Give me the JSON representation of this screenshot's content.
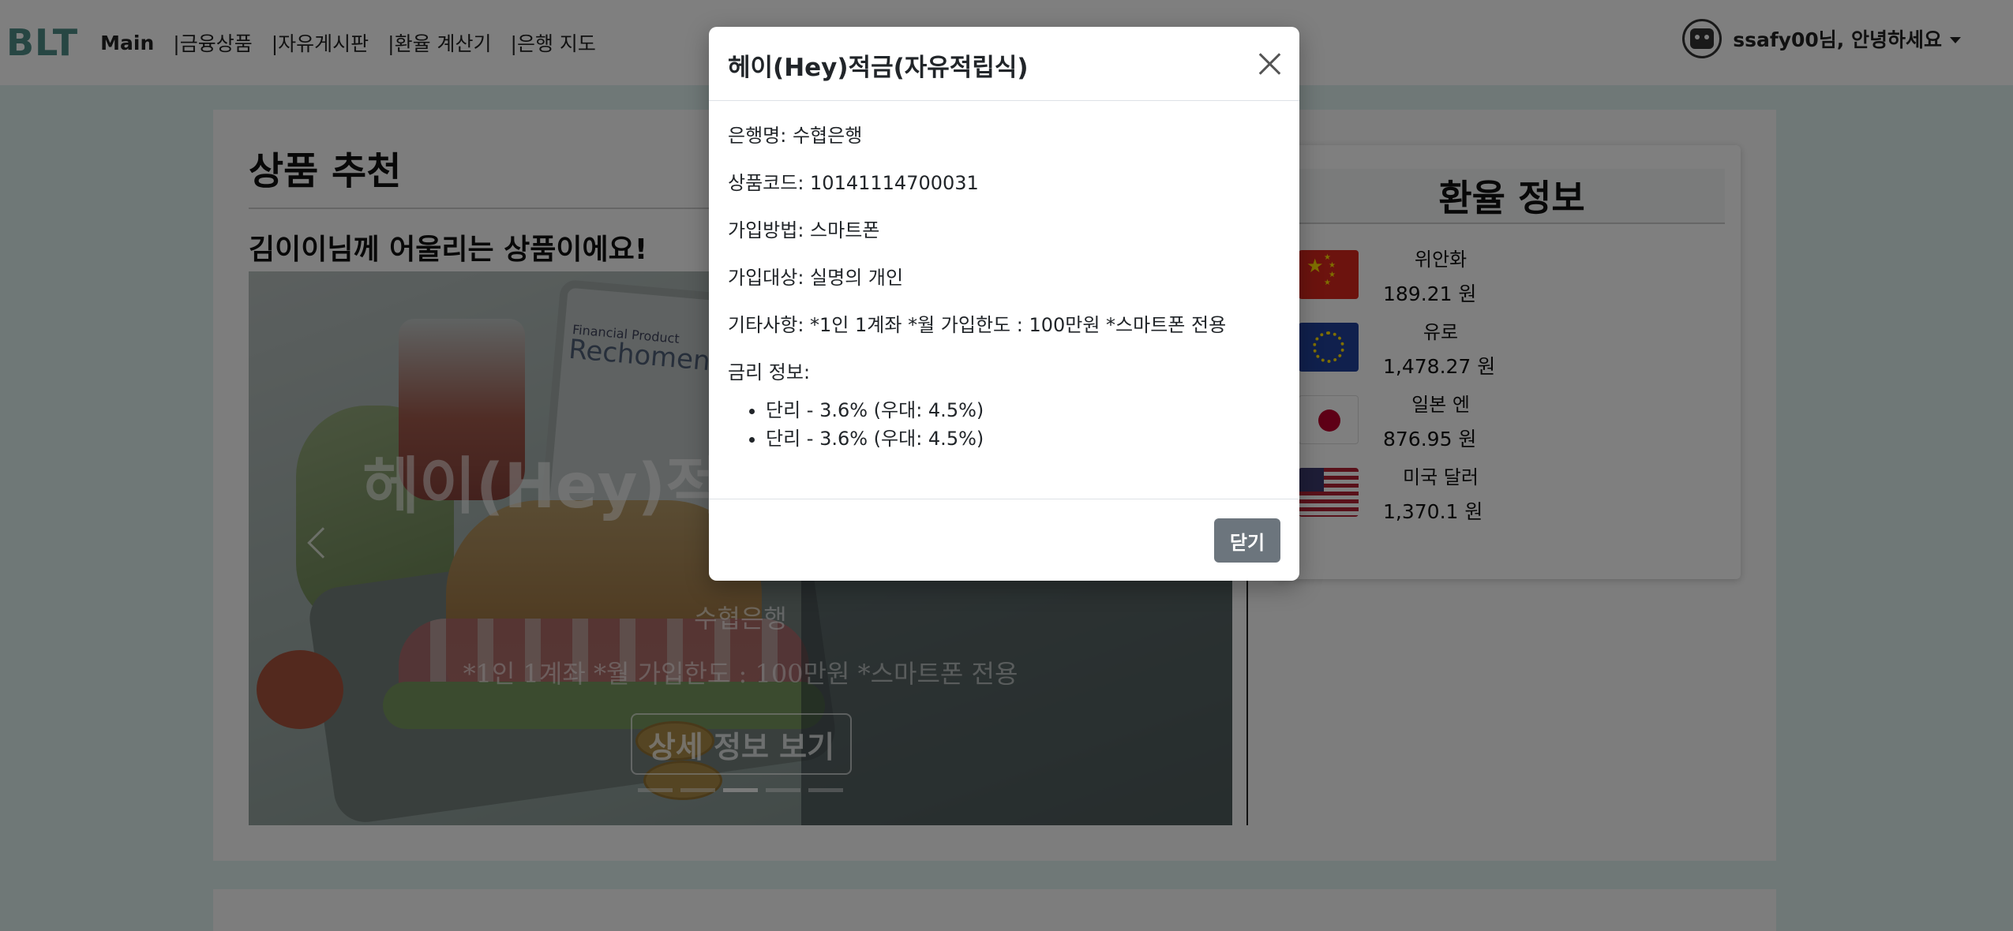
{
  "navbar": {
    "brand": "BLT",
    "links": [
      "Main",
      "|금융상품",
      "|자유게시판",
      "|환율 계산기",
      "|은행 지도"
    ],
    "greeting": "ssafy00님, 안녕하세요",
    "avatar_icon": "robot-avatar-icon"
  },
  "recommendation": {
    "title": "상품 추천",
    "subtitle": "김이이님께 어울리는 상품이에요!",
    "carousel": {
      "image_text_top": "Financial Product",
      "image_text_main": "Rechomenentiony",
      "slide_title": "헤이(Hey)적금(자유적립식)",
      "slide_bank": "수협은행",
      "slide_note": "*1인 1계좌 *월 가입한도 : 100만원 *스마트폰 전용",
      "detail_button": "상세 정보 보기",
      "indicator_count": 5,
      "active_indicator": 3
    }
  },
  "exchange": {
    "title": "환율 정보",
    "currencies": [
      {
        "name": "위안화",
        "rate": "189.21 원",
        "flag": "china-flag-icon"
      },
      {
        "name": "유로",
        "rate": "1,478.27 원",
        "flag": "eu-flag-icon"
      },
      {
        "name": "일본 엔",
        "rate": "876.95 원",
        "flag": "japan-flag-icon"
      },
      {
        "name": "미국 달러",
        "rate": "1,370.1 원",
        "flag": "usa-flag-icon"
      }
    ]
  },
  "modal": {
    "title": "헤이(Hey)적금(자유적립식)",
    "bank": "은행명: 수협은행",
    "code": "상품코드: 10141114700031",
    "join_way": "가입방법: 스마트폰",
    "join_member": "가입대상: 실명의 개인",
    "etc": "기타사항: *1인 1계좌 *월 가입한도 : 100만원 *스마트폰 전용",
    "rate_label": "금리 정보:",
    "rates": [
      "단리 - 3.6% (우대: 4.5%)",
      "단리 - 3.6% (우대: 4.5%)"
    ],
    "close_button": "닫기"
  },
  "colors": {
    "brand": "#4e8c86",
    "page_bg": "#dff0ee",
    "close_button_bg": "#6c757d"
  }
}
